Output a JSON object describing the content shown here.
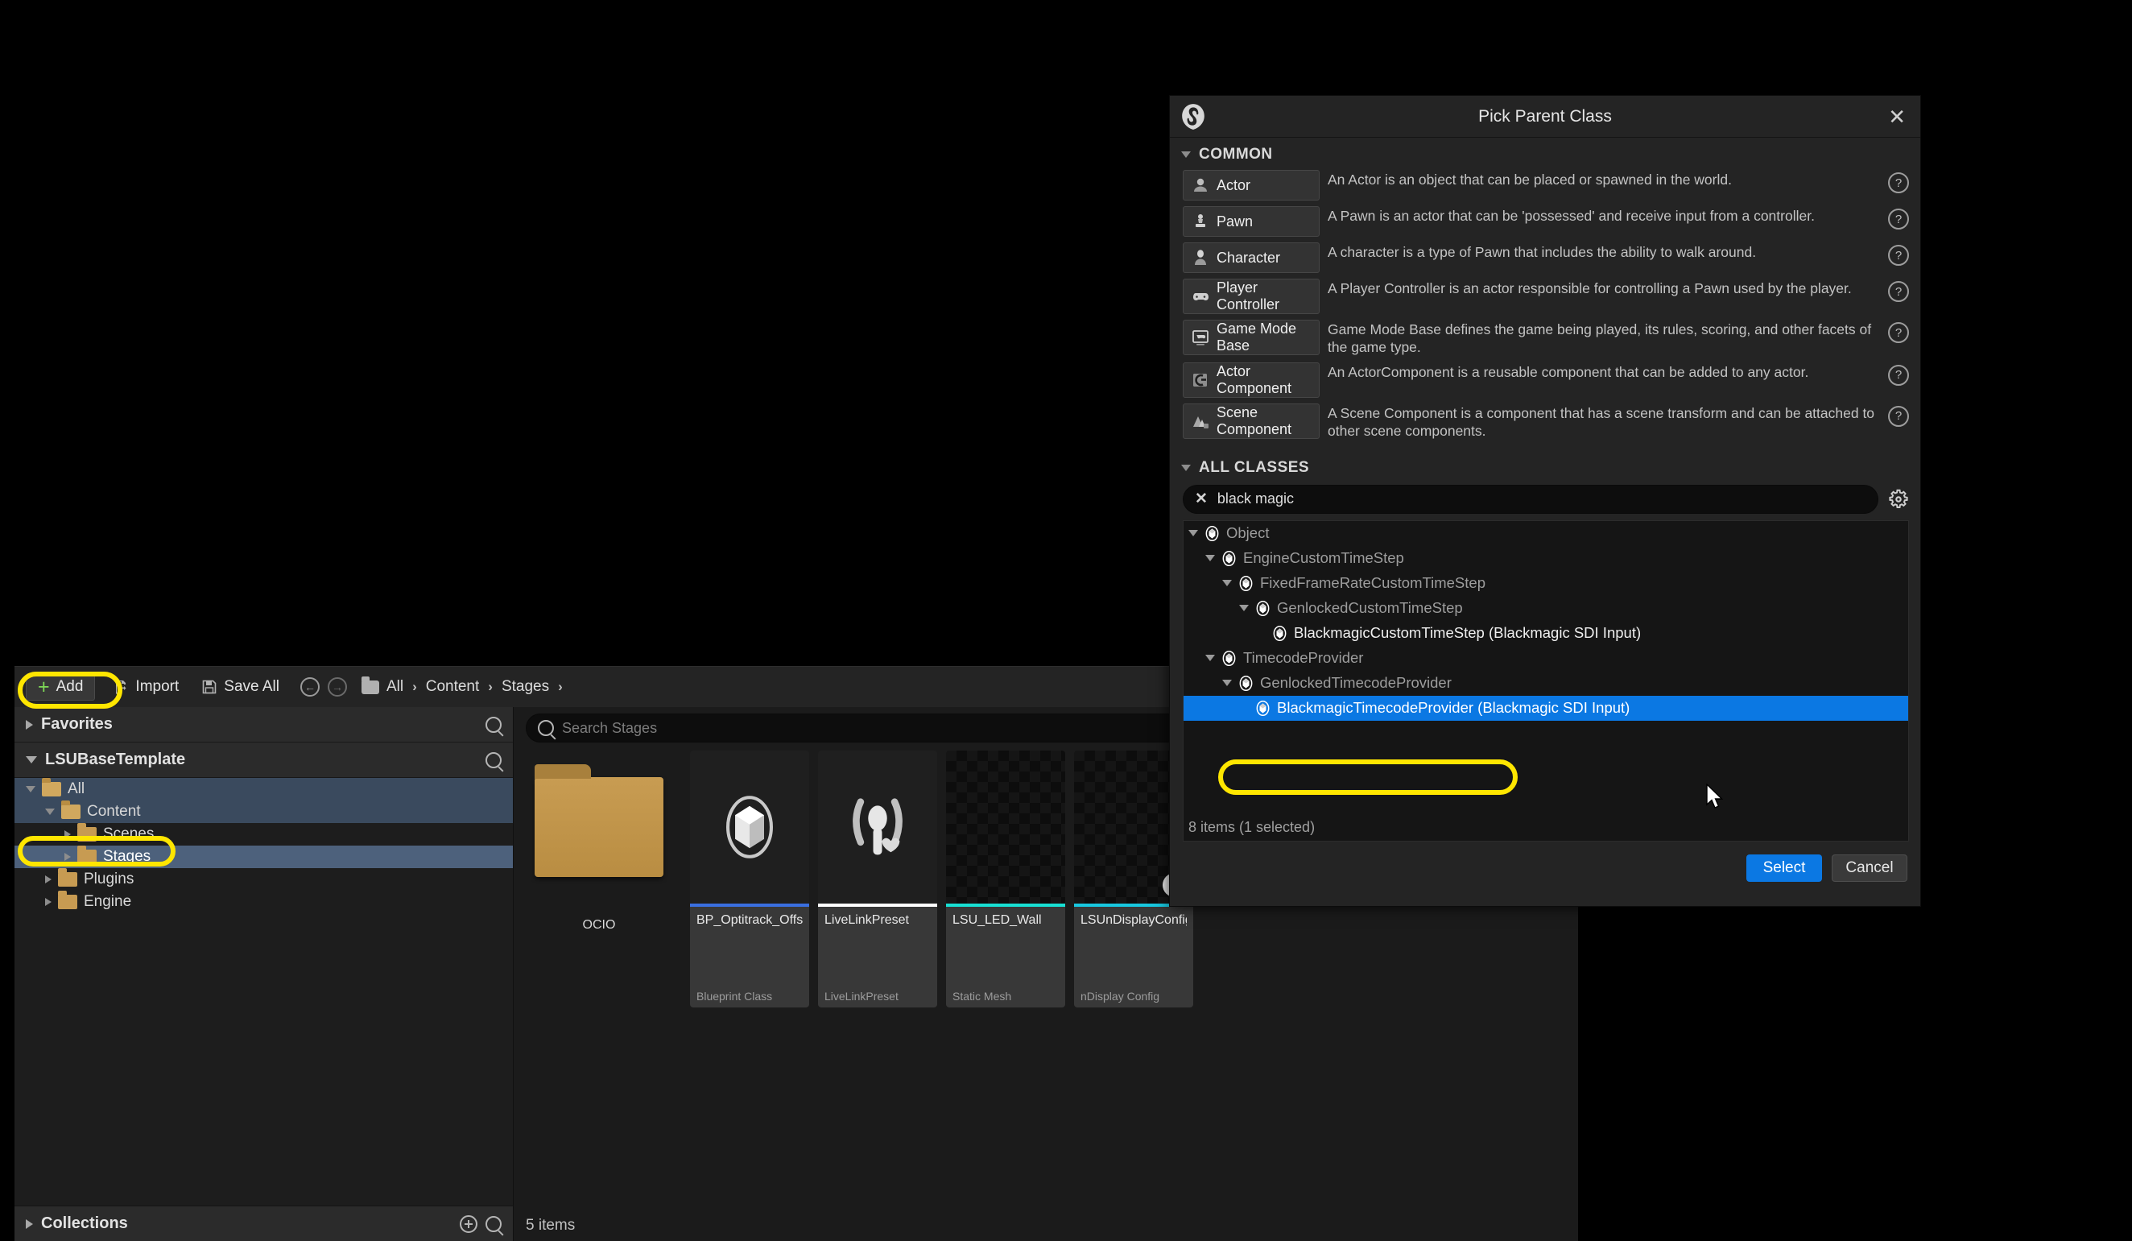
{
  "content_browser": {
    "toolbar": {
      "add_label": "Add",
      "import_label": "Import",
      "save_all_label": "Save All",
      "back_icon": "back-arrow-icon",
      "forward_icon": "forward-arrow-icon",
      "breadcrumbs": [
        "All",
        "Content",
        "Stages"
      ],
      "crumb_sep": "›"
    },
    "left_panel": {
      "favorites_label": "Favorites",
      "project_label": "LSUBaseTemplate",
      "tree": [
        {
          "label": "All",
          "depth": 0,
          "expanded": true,
          "selected": true
        },
        {
          "label": "Content",
          "depth": 1,
          "expanded": true,
          "selected": true
        },
        {
          "label": "Scenes",
          "depth": 2,
          "expanded": false,
          "selected": false
        },
        {
          "label": "Stages",
          "depth": 2,
          "expanded": false,
          "selected": "strong"
        },
        {
          "label": "Plugins",
          "depth": 1,
          "expanded": false,
          "selected": false
        },
        {
          "label": "Engine",
          "depth": 1,
          "expanded": false,
          "selected": false
        }
      ],
      "collections_label": "Collections"
    },
    "asset_view": {
      "search_placeholder": "Search Stages",
      "items_count": "5 items",
      "folders": [
        {
          "name": "OCIO"
        }
      ],
      "assets": [
        {
          "name": "BP_Optitrack_Offset",
          "type": "Blueprint Class",
          "accent": "#3a6fe0",
          "thumb": "blueprint-cube-icon"
        },
        {
          "name": "LiveLinkPreset",
          "type": "LiveLinkPreset",
          "accent": "#ffffff",
          "thumb": "livelink-icon"
        },
        {
          "name": "LSU_LED_Wall",
          "type": "Static Mesh",
          "accent": "#18e0d4",
          "thumb": "checker-dark"
        },
        {
          "name": "LSUnDisplayConfig",
          "type": "nDisplay Config",
          "accent": "#18c8e0",
          "thumb": "checker-dark-ndisplay"
        }
      ]
    }
  },
  "modal": {
    "title": "Pick Parent Class",
    "close_icon": "close-icon",
    "logo_icon": "unreal-logo-icon",
    "common": {
      "header": "COMMON",
      "items": [
        {
          "label": "Actor",
          "icon": "actor-icon",
          "description": "An Actor is an object that can be placed or spawned in the world."
        },
        {
          "label": "Pawn",
          "icon": "pawn-icon",
          "description": "A Pawn is an actor that can be 'possessed' and receive input from a controller."
        },
        {
          "label": "Character",
          "icon": "character-icon",
          "description": "A character is a type of Pawn that includes the ability to walk around."
        },
        {
          "label": "Player Controller",
          "icon": "gamepad-icon",
          "description": "A Player Controller is an actor responsible for controlling a Pawn used by the player."
        },
        {
          "label": "Game Mode Base",
          "icon": "game-mode-icon",
          "description": "Game Mode Base defines the game being played, its rules, scoring, and other facets of the game type."
        },
        {
          "label": "Actor Component",
          "icon": "actor-component-icon",
          "description": "An ActorComponent is a reusable component that can be added to any actor."
        },
        {
          "label": "Scene Component",
          "icon": "scene-component-icon",
          "description": "A Scene Component is a component that has a scene transform and can be attached to other scene components."
        }
      ]
    },
    "all_classes": {
      "header": "ALL CLASSES",
      "search_value": "black magic",
      "search_clear_icon": "clear-x-icon",
      "settings_icon": "gear-icon",
      "tree": [
        {
          "label": "Object",
          "depth": 0,
          "expandable": true,
          "selected": false
        },
        {
          "label": "EngineCustomTimeStep",
          "depth": 1,
          "expandable": true,
          "selected": false
        },
        {
          "label": "FixedFrameRateCustomTimeStep",
          "depth": 2,
          "expandable": true,
          "selected": false
        },
        {
          "label": "GenlockedCustomTimeStep",
          "depth": 3,
          "expandable": true,
          "selected": false
        },
        {
          "label": "BlackmagicCustomTimeStep (Blackmagic SDI Input)",
          "depth": 4,
          "expandable": false,
          "selected": false
        },
        {
          "label": "TimecodeProvider",
          "depth": 1,
          "expandable": true,
          "selected": false
        },
        {
          "label": "GenlockedTimecodeProvider",
          "depth": 2,
          "expandable": true,
          "selected": false
        },
        {
          "label": "BlackmagicTimecodeProvider (Blackmagic SDI Input)",
          "depth": 3,
          "expandable": false,
          "selected": true
        }
      ],
      "status": "8 items (1 selected)"
    },
    "footer": {
      "select_label": "Select",
      "cancel_label": "Cancel"
    }
  },
  "annotations": {
    "highlight_color": "#ffe600",
    "targets": [
      "add-button",
      "sidebar-stages-folder",
      "selected-class-row"
    ]
  },
  "colors": {
    "accent_blue": "#0b78e3",
    "selection_blue": "#0b78e3",
    "highlight_yellow": "#ffe600",
    "folder_gold": "#c89c52"
  }
}
